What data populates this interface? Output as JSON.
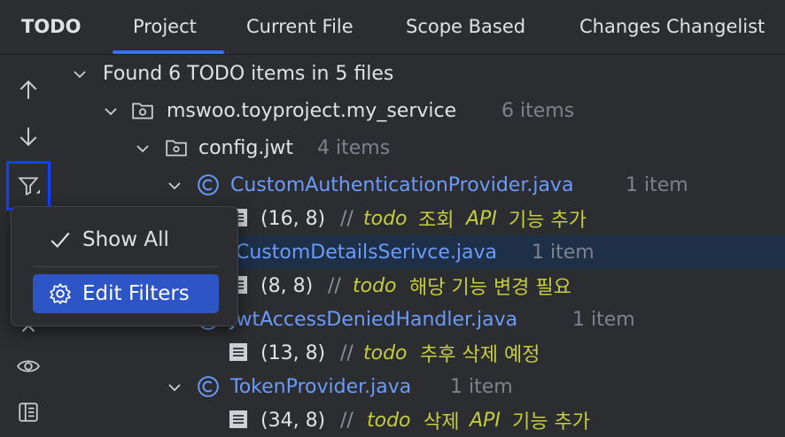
{
  "tabs": {
    "title": "TODO",
    "items": [
      "Project",
      "Current File",
      "Scope Based",
      "Changes Changelist"
    ],
    "active": "Project"
  },
  "toolbar": {
    "icons": [
      "arrow-up-icon",
      "arrow-down-icon",
      "filter-icon",
      "close-icon",
      "eye-icon",
      "preview-icon"
    ]
  },
  "tree": {
    "root": "Found 6 TODO items in 5 files",
    "module": {
      "name": "mswoo.toyproject.my_service",
      "count": "6 items"
    },
    "package": {
      "name": "config.jwt",
      "count": "4 items"
    },
    "files": [
      {
        "name": "CustomAuthenticationProvider.java",
        "count": "1 item",
        "loc": "(16, 8)",
        "slash": "//",
        "keyword": "todo",
        "text": "조회",
        "api": "API",
        "rest": "기능 추가"
      },
      {
        "name": "CustomDetailsSerivce.java",
        "count": "1 item",
        "loc": "(8, 8)",
        "slash": "//",
        "keyword": "todo",
        "text": "해당 기능 변경 필요"
      },
      {
        "name": "JwtAccessDeniedHandler.java",
        "count": "1 item",
        "loc": "(13, 8)",
        "slash": "//",
        "keyword": "todo",
        "text": "추후 삭제 예정"
      },
      {
        "name": "TokenProvider.java",
        "count": "1 item",
        "loc": "(34, 8)",
        "slash": "//",
        "keyword": "todo",
        "text": "삭제",
        "api": "API",
        "rest": "기능 추가"
      }
    ]
  },
  "popup": {
    "show_all": "Show All",
    "edit_filters": "Edit Filters"
  },
  "colors": {
    "accent": "#3574f0",
    "highlight": "#2e55c5",
    "todo": "#c6cc3e",
    "class_link": "#6b9bfa"
  }
}
